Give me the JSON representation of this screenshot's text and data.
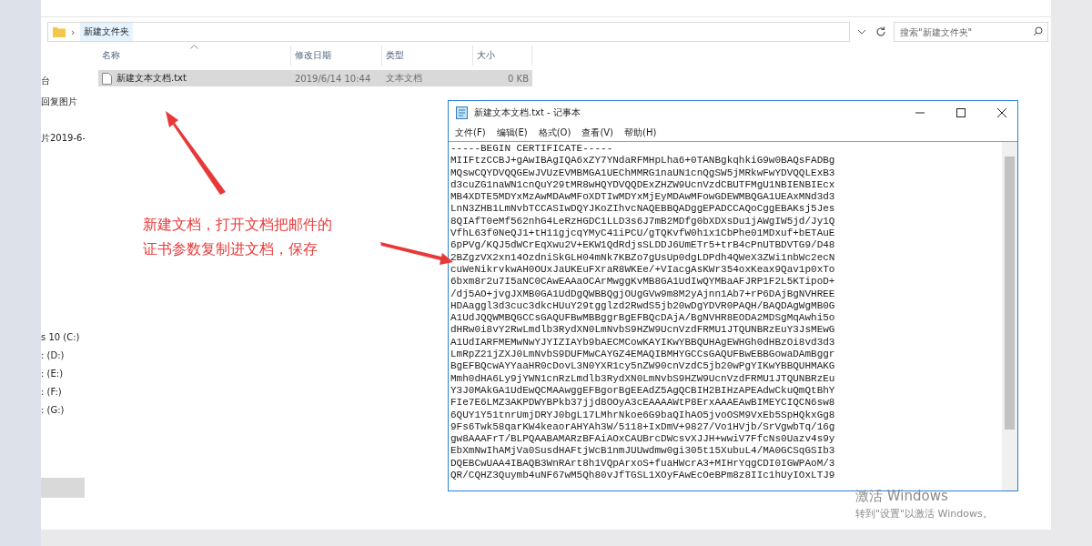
{
  "explorer": {
    "breadcrumb": "新建文件夹",
    "breadcrumb_separator": "›",
    "search": {
      "placeholder": "搜索\"新建文件夹\""
    },
    "nav_items": [
      {
        "label": "台",
        "selected": false
      },
      {
        "label": "回复图片",
        "selected": false
      },
      {
        "label": "片2019-6-",
        "selected": false
      },
      {
        "label": "s 10 (C:)",
        "selected": false
      },
      {
        "label": ": (D:)",
        "selected": false
      },
      {
        "label": ": (E:)",
        "selected": false
      },
      {
        "label": ": (F:)",
        "selected": false
      },
      {
        "label": ": (G:)",
        "selected": false
      },
      {
        "selected": true
      }
    ],
    "columns": [
      "名称",
      "修改日期",
      "类型",
      "大小"
    ],
    "files": [
      {
        "name": "新建文本文档.txt",
        "modified": "2019/6/14 10:44",
        "type": "文本文档",
        "size": "0 KB",
        "selected": true
      }
    ]
  },
  "notepad": {
    "title": "新建文本文档.txt - 记事本",
    "menu": [
      "文件(F)",
      "编辑(E)",
      "格式(O)",
      "查看(V)",
      "帮助(H)"
    ],
    "lines": [
      "-----BEGIN CERTIFICATE-----",
      "MIIFtzCCBJ+gAwIBAgIQA6xZY7YNdaRFMHpLha6+0TANBgkqhkiG9w0BAQsFADBg",
      "MQswCQYDVQQGEwJVUzEVMBMGA1UEChMMRG1naUN1cnQgSW5jMRkwFwYDVQQLExB3",
      "d3cuZG1naWN1cnQuY29tMR8wHQYDVQQDExZHZW9UcnVzdCBUTFMgU1NBIENBIEcx",
      "MB4XDTE5MDYxMzAwMDAwMFoXDTIwMDYxMjEyMDAwMFowGDEWMBQGA1UEAxMNd3d3",
      "LnN3ZHB1LmNvbTCCASIwDQYJKoZIhvcNAQEBBQADggEPADCCAQoCggEBAKsj5Jes",
      "8QIAfT0eMf562nhG4LeRzHGDC1LLD3s6J7mB2MDfg0bXDXsDu1jAWgIW5jd/Jy1Q",
      "VfhL63f0NeQJ1+tH11gjcqYMyC41iPCU/gTQKvfW0h1x1CbPhe01MDxuf+bETAuE",
      "6pPVg/KQJ5dWCrEqXwu2V+EKW1QdRdjsSLDDJ6UmETr5+trB4cPnUTBDVTG9/D48",
      "2BZgzVX2xn14OzdniSkGLH04mNk7KBZo7gUsUp0dgLDPdh4QWeX3ZWi1nbWc2ecN",
      "cuWeNikrvkwAH0OUxJaUKEuFXraR8WKEe/+VIacgAsKWr354oxKeax9Qav1p0xTo",
      "6bxm8r2u7I5aNC0CAwEAAaOCArMwggKvMB8GA1UdIwQYMBaAFJRP1F2L5KTipoD+",
      "/dj5AO+jvgJXMB0GA1UdDgQWBBQgjOUgGVw9m8M2yAjnn1Ab7+rP6DAjBgNVHREE",
      "HDAaggl3d3cuc3dkcHUuY29tgglzd2RwdS5jb20wDgYDVR0PAQH/BAQDAgWgMB0G",
      "A1UdJQQWMBQGCCsGAQUFBwMBBggrBgEFBQcDAjA/BgNVHR8EODA2MDSgMqAwhi5o",
      "dHRw0i8vY2RwLmdlb3RydXN0LmNvbS9HZW9UcnVzdFRMU1JTQUNBRzEuY3JsMEwG",
      "A1UdIARFMEMwNwYJYIZIAYb9bAECMCowKAYIKwYBBQUHAgEWHGh0dHBzOi8vd3d3",
      "LmRpZ21jZXJ0LmNvbS9DUFMwCAYGZ4EMAQIBMHYGCCsGAQUFBwEBBGowaDAmBggr",
      "BgEFBQcwAYYaaHR0cDovL3N0YXR1cy5nZW90cnVzdC5jb20wPgYIKwYBBQUHMAKG",
      "Mmh0dHA6Ly9jYWN1cnRzLmdlb3RydXN0LmNvbS9HZW9UcnVzdFRMU1JTQUNBRzEu",
      "Y3J0MAkGA1UdEwQCMAAwggEFBgorBgEEAdZ5AgQCBIH2BIHzAPEAdwCkuQmQtBhY",
      "FIe7E6LMZ3AKPDWYBPkb37jjd8OOyA3cEAAAAWtP8ErxAAAEAwBIMEYCIQCN6sw8",
      "6QUY1Y51tnrUmjDRYJ0bgL17LMhrNkoe6G9baQIhAO5jvoOSM9VxEb5SpHQkxGg8",
      "9Fs6Twk58qarKW4keaorAHYAh3W/5118+IxDmV+9827/Vo1HVjb/SrVgwbTq/16g",
      "gw8AAAFrT/BLPQAABAMARzBFAiAOxCAUBrcDWcsvXJJH+wwiV7FfcNs0Uazv4s9y",
      "EbXmNwIhAMjVa0SusdHAFtjWcB1nmJUUwdmw0gi305t15XubuL4/MA0GCSqGSIb3",
      "DQEBCwUAA4IBAQB3WnRArt8h1VQpArxoS+fuaHWcrA3+MIHrYqgCDI0IGWPAoM/3",
      "QR/CQHZ3Quymb4uNF67wM5Qh80vJfTGSL1XOyFAwEcOeBPm8z8IIc1hUyIOxLTJ9"
    ]
  },
  "annotation": {
    "lines": [
      "新建文档，打开文档把邮件的",
      "证书参数复制进文档，保存"
    ]
  },
  "activation": {
    "title": "激活 Windows",
    "hint": "转到\"设置\"以激活 Windows。"
  }
}
